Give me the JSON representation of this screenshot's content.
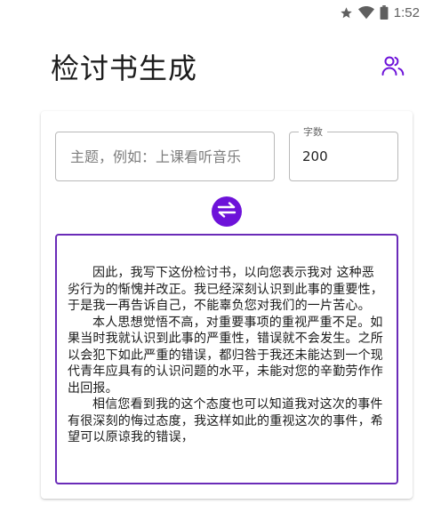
{
  "status_bar": {
    "time": "1:52",
    "icons": [
      "star-icon",
      "wifi-icon",
      "battery-icon"
    ]
  },
  "app": {
    "title": "检讨书生成",
    "accent_color": "#6d12d9",
    "users_icon": "users-icon"
  },
  "form": {
    "topic_placeholder": "主题，例如：上课看听音乐",
    "topic_value": "",
    "count_label": "字数",
    "count_value": "200",
    "generate_icon": "swap-arrows-icon"
  },
  "result": {
    "paragraphs": [
      "因此，我写下这份检讨书，以向您表示我对 这种恶劣行为的惭愧并改正。我已经深刻认识到此事的重要性，于是我一再告诉自己，不能辜负您对我们的一片苦心。",
      "本人思想觉悟不高，对重要事项的重视严重不足。如果当时我就认识到此事的严重性，错误就不会发生。之所以会犯下如此严重的错误，都归咎于我还未能达到一个现代青年应具有的认识问题的水平，未能对您的辛勤劳作作出回报。",
      "相信您看到我的这个态度也可以知道我对这次的事件有很深刻的悔过态度，我这样如此的重视这次的事件，希望可以原谅我的错误，"
    ]
  }
}
